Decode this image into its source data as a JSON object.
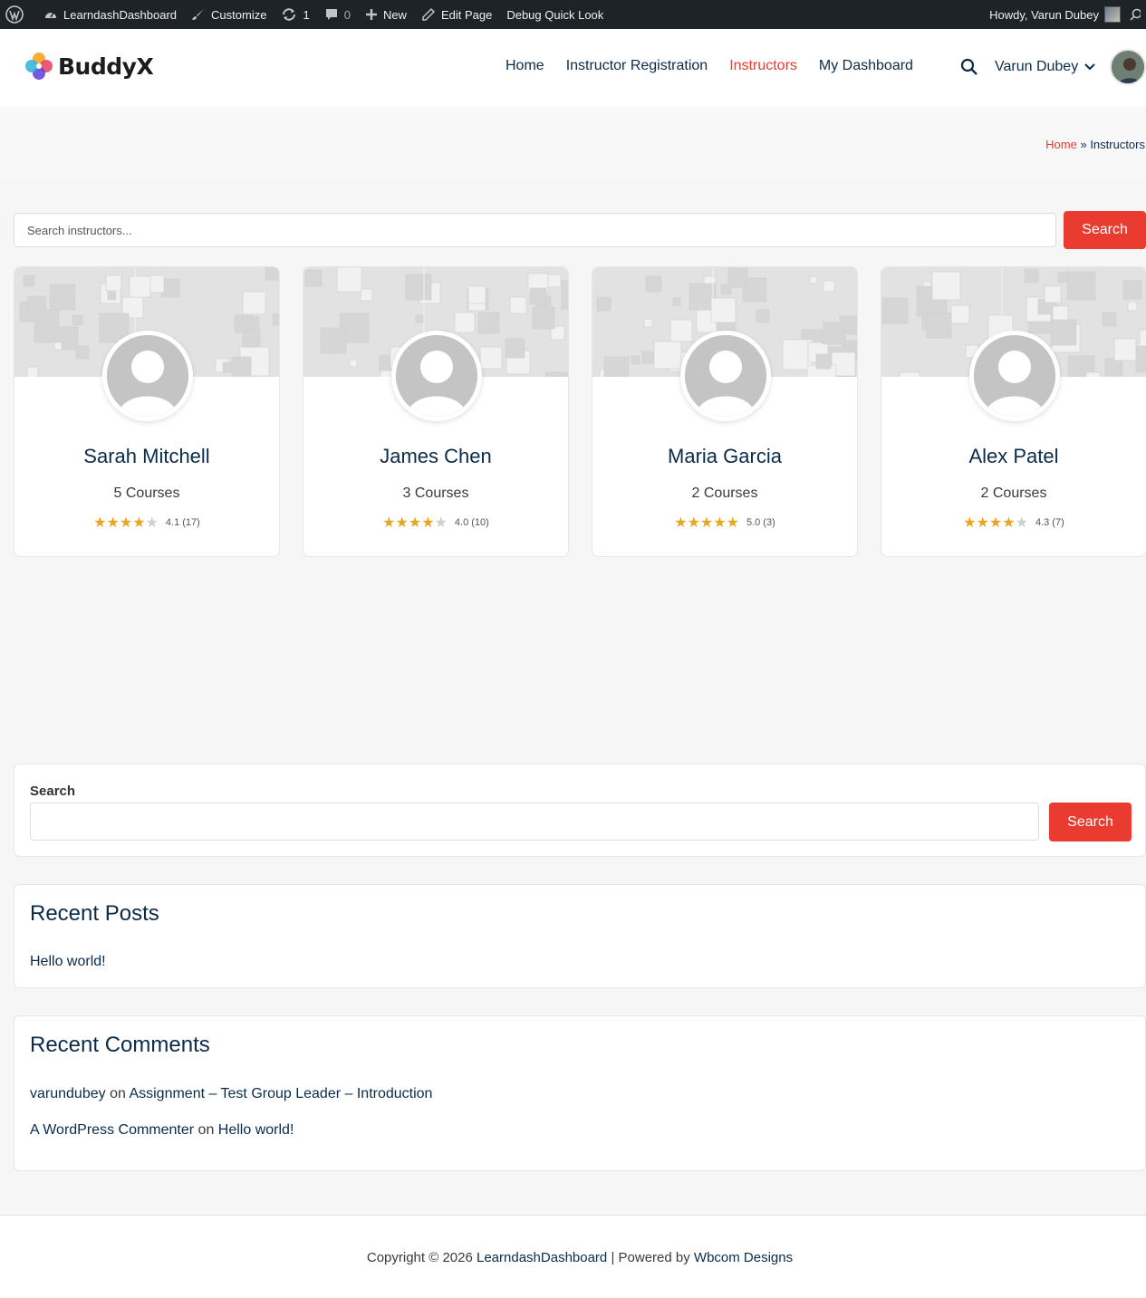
{
  "adminbar": {
    "site": "LearndashDashboard",
    "customize": "Customize",
    "updates": "1",
    "comments": "0",
    "new": "New",
    "edit": "Edit Page",
    "debug": "Debug Quick Look",
    "howdy": "Howdy, Varun Dubey"
  },
  "header": {
    "logo": "BuddyX",
    "nav": [
      "Home",
      "Instructor Registration",
      "Instructors",
      "My Dashboard"
    ],
    "active_nav": "Instructors",
    "user": "Varun Dubey"
  },
  "breadcrumb": {
    "home": "Home",
    "sep": "»",
    "current": "Instructors"
  },
  "search": {
    "placeholder": "Search instructors...",
    "button": "Search"
  },
  "instructors": [
    {
      "name": "Sarah Mitchell",
      "courses": "5 Courses",
      "stars": 4,
      "rating": "4.1 (17)"
    },
    {
      "name": "James Chen",
      "courses": "3 Courses",
      "stars": 4,
      "rating": "4.0 (10)"
    },
    {
      "name": "Maria Garcia",
      "courses": "2 Courses",
      "stars": 5,
      "rating": "5.0 (3)"
    },
    {
      "name": "Alex Patel",
      "courses": "2 Courses",
      "stars": 4,
      "rating": "4.3 (7)"
    }
  ],
  "widgets": {
    "search": {
      "label": "Search",
      "button": "Search"
    },
    "recent_posts": {
      "title": "Recent Posts",
      "items": [
        "Hello world!"
      ]
    },
    "recent_comments": {
      "title": "Recent Comments",
      "items": [
        {
          "author": "varundubey",
          "on": "on",
          "post": "Assignment – Test Group Leader – Introduction"
        },
        {
          "author": "A WordPress Commenter",
          "on": "on",
          "post": "Hello world!"
        }
      ]
    }
  },
  "footer": {
    "prefix": "Copyright © 2026",
    "site": "LearndashDashboard",
    "middle": "| Powered by",
    "company": "Wbcom Designs"
  },
  "colors": {
    "accent": "#e93b2f",
    "text": "#0b2b4a",
    "star": "#e8a623",
    "adminbar": "#1d2327"
  }
}
